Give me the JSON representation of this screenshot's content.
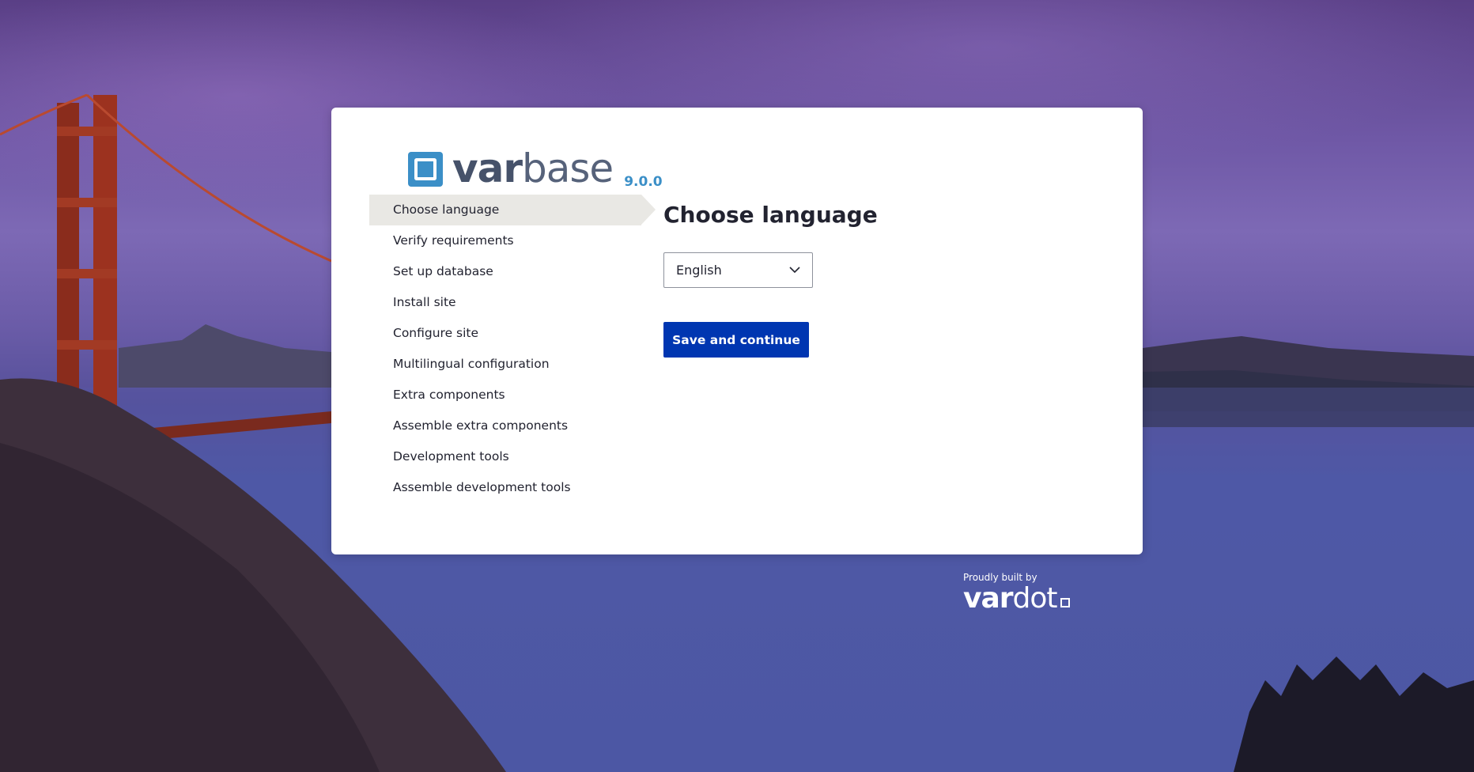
{
  "installer": {
    "logo_text_var": "var",
    "logo_text_base": "base",
    "version": "9.0.0",
    "steps": [
      {
        "label": "Choose language",
        "active": true
      },
      {
        "label": "Verify requirements",
        "active": false
      },
      {
        "label": "Set up database",
        "active": false
      },
      {
        "label": "Install site",
        "active": false
      },
      {
        "label": "Configure site",
        "active": false
      },
      {
        "label": "Multilingual configuration",
        "active": false
      },
      {
        "label": "Extra components",
        "active": false
      },
      {
        "label": "Assemble extra components",
        "active": false
      },
      {
        "label": "Development tools",
        "active": false
      },
      {
        "label": "Assemble development tools",
        "active": false
      }
    ],
    "title": "Choose language",
    "language_select": {
      "value": "English"
    },
    "save_button_label": "Save and continue"
  },
  "footer": {
    "built_by": "Proudly built by",
    "brand_var": "var",
    "brand_dot": "dot"
  },
  "colors": {
    "accent": "#3b8fc7",
    "primary_button": "#0036b1",
    "active_step_bg": "#e9e8e4"
  }
}
